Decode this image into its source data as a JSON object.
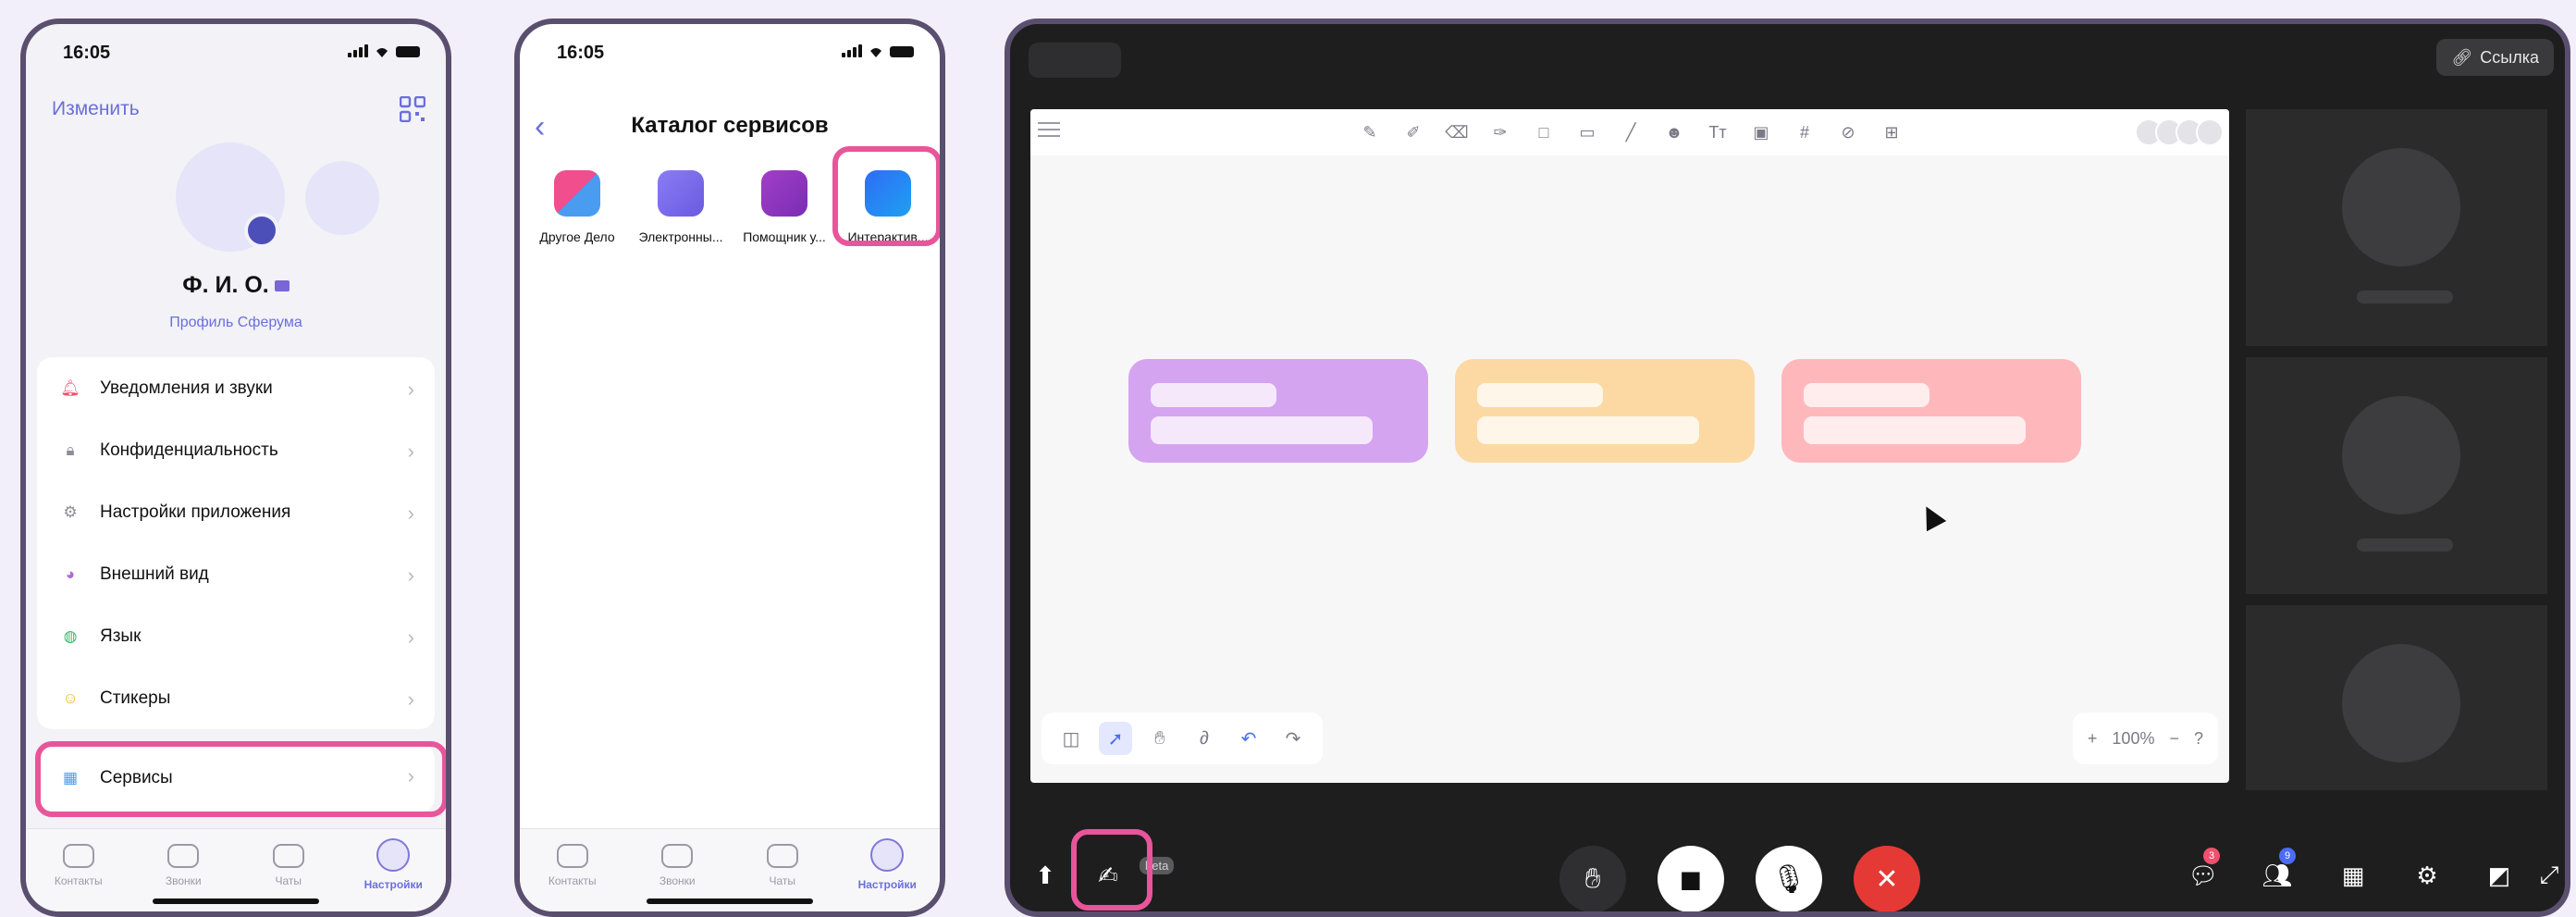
{
  "phone_profile": {
    "time": "16:05",
    "edit_label": "Изменить",
    "name": "Ф. И. О.",
    "profile_link": "Профиль Сферума",
    "menu": [
      {
        "label": "Уведомления и звуки",
        "icon": "bell-icon",
        "color": "#f0506e"
      },
      {
        "label": "Конфиденциальность",
        "icon": "lock-icon",
        "color": "#8e8e99"
      },
      {
        "label": "Настройки приложения",
        "icon": "gear-icon",
        "color": "#8e8e99"
      },
      {
        "label": "Внешний вид",
        "icon": "palette-icon",
        "color": "#b06ad8"
      },
      {
        "label": "Язык",
        "icon": "globe-icon",
        "color": "#3bb56a"
      },
      {
        "label": "Стикеры",
        "icon": "smile-icon",
        "color": "#f2b531"
      }
    ],
    "services_item": {
      "label": "Сервисы",
      "icon": "grid-icon",
      "color": "#4a9cf0"
    },
    "highlight_color": "#e8559a"
  },
  "tabbar": {
    "tabs": [
      {
        "label": "Контакты",
        "icon": "contacts-icon"
      },
      {
        "label": "Звонки",
        "icon": "phone-icon"
      },
      {
        "label": "Чаты",
        "icon": "chat-icon"
      },
      {
        "label": "Настройки",
        "icon": "settings-avatar-icon",
        "active": true
      }
    ]
  },
  "phone_catalog": {
    "time": "16:05",
    "title": "Каталог сервисов",
    "apps": [
      {
        "label": "Другое Дело",
        "icon": "drugoe-delo-icon",
        "color": "#f04e8c"
      },
      {
        "label": "Электронны...",
        "icon": "electronic-journal-icon",
        "color": "#7b6df0"
      },
      {
        "label": "Помощник у...",
        "icon": "assistant-icon",
        "color": "#a23fc7"
      },
      {
        "label": "Интерактив...",
        "icon": "interactive-board-icon",
        "color": "#2f6cf5"
      }
    ]
  },
  "meeting": {
    "link_label": "Ссылка",
    "zoom": "100%",
    "beta_label": "beta",
    "chat_badge": "3",
    "participants_badge": "9",
    "cards": [
      {
        "color": "#d5a4f0"
      },
      {
        "color": "#fcd9a3"
      },
      {
        "color": "#feb8bc"
      }
    ],
    "end_call_color": "#e53935"
  }
}
